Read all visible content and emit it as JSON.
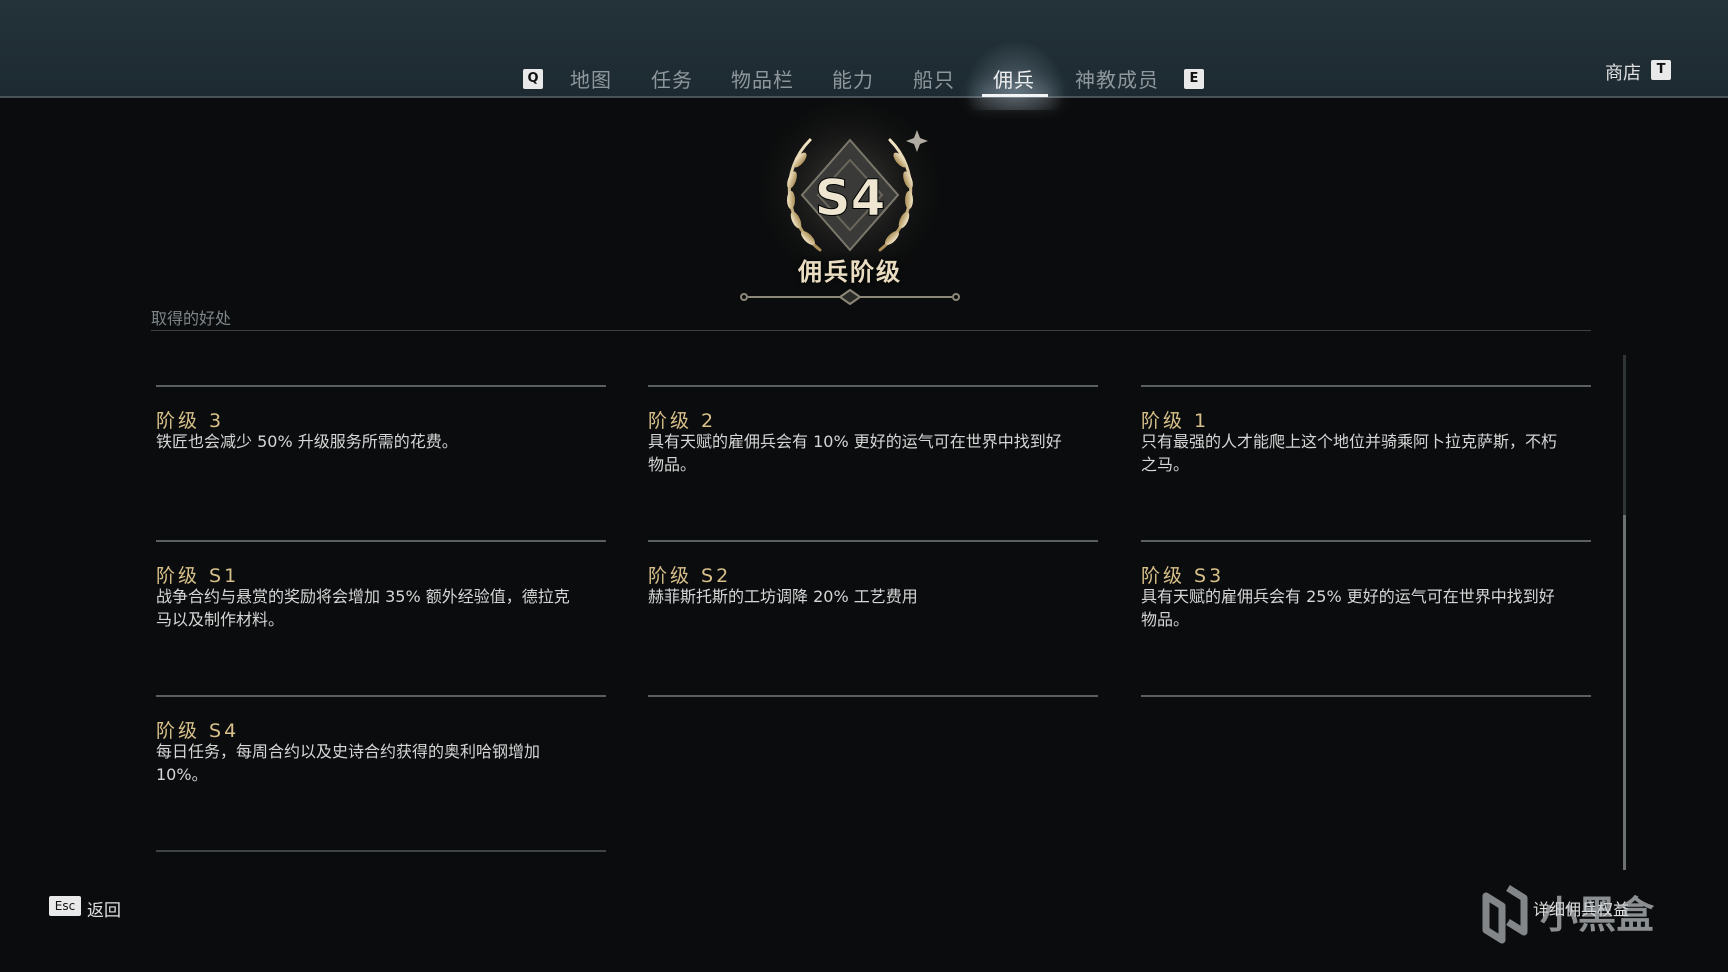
{
  "nav": {
    "left_key": "Q",
    "right_key": "E",
    "tabs": [
      {
        "label": "地图"
      },
      {
        "label": "任务"
      },
      {
        "label": "物品栏"
      },
      {
        "label": "能力"
      },
      {
        "label": "船只"
      },
      {
        "label": "佣兵",
        "active": true
      },
      {
        "label": "神教成员"
      }
    ],
    "shop_label": "商店",
    "shop_key": "T"
  },
  "emblem": {
    "rank_code": "S4",
    "title": "佣兵阶级"
  },
  "section_label": "取得的好处",
  "ranks": [
    {
      "title": "阶级 3",
      "desc": "铁匠也会减少 50% 升级服务所需的花费。"
    },
    {
      "title": "阶级 2",
      "desc": "具有天赋的雇佣兵会有 10% 更好的运气可在世界中找到好物品。"
    },
    {
      "title": "阶级 1",
      "desc": "只有最强的人才能爬上这个地位并骑乘阿卜拉克萨斯，不朽之马。"
    },
    {
      "title": "阶级 S1",
      "desc": "战争合约与悬赏的奖励将会增加 35% 额外经验值，德拉克马以及制作材料。"
    },
    {
      "title": "阶级 S2",
      "desc": "赫菲斯托斯的工坊调降 20% 工艺费用"
    },
    {
      "title": "阶级 S3",
      "desc": "具有天赋的雇佣兵会有 25% 更好的运气可在世界中找到好物品。"
    },
    {
      "title": "阶级 S4",
      "desc": "每日任务，每周合约以及史诗合约获得的奥利哈钢增加 10%。"
    }
  ],
  "footer": {
    "back_key": "Esc",
    "back_label": "返回",
    "detail_label": "详细佣兵权益"
  },
  "watermark": {
    "text": "小黑盒"
  },
  "colors": {
    "accent_gold": "#d8c08a",
    "topbar": "#1f2d34",
    "background": "#0b0c0d"
  }
}
